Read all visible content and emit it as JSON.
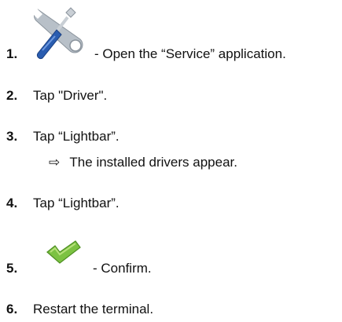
{
  "steps": [
    {
      "number": "1.",
      "icon": "wrench-screwdriver-icon",
      "text": "- Open the “Service” application."
    },
    {
      "number": "2.",
      "text": "Tap \"Driver\"."
    },
    {
      "number": "3.",
      "text": "Tap “Lightbar”.",
      "result": "The installed drivers appear."
    },
    {
      "number": "4.",
      "text": "Tap “Lightbar”."
    },
    {
      "number": "5.",
      "icon": "checkmark-icon",
      "text": "- Confirm."
    },
    {
      "number": "6.",
      "text": "Restart the terminal."
    }
  ],
  "result_arrow": "⇨",
  "colors": {
    "checkmark_green": "#7cc242",
    "screwdriver_blue": "#2a5db0",
    "wrench_gray": "#9aa3ad"
  }
}
